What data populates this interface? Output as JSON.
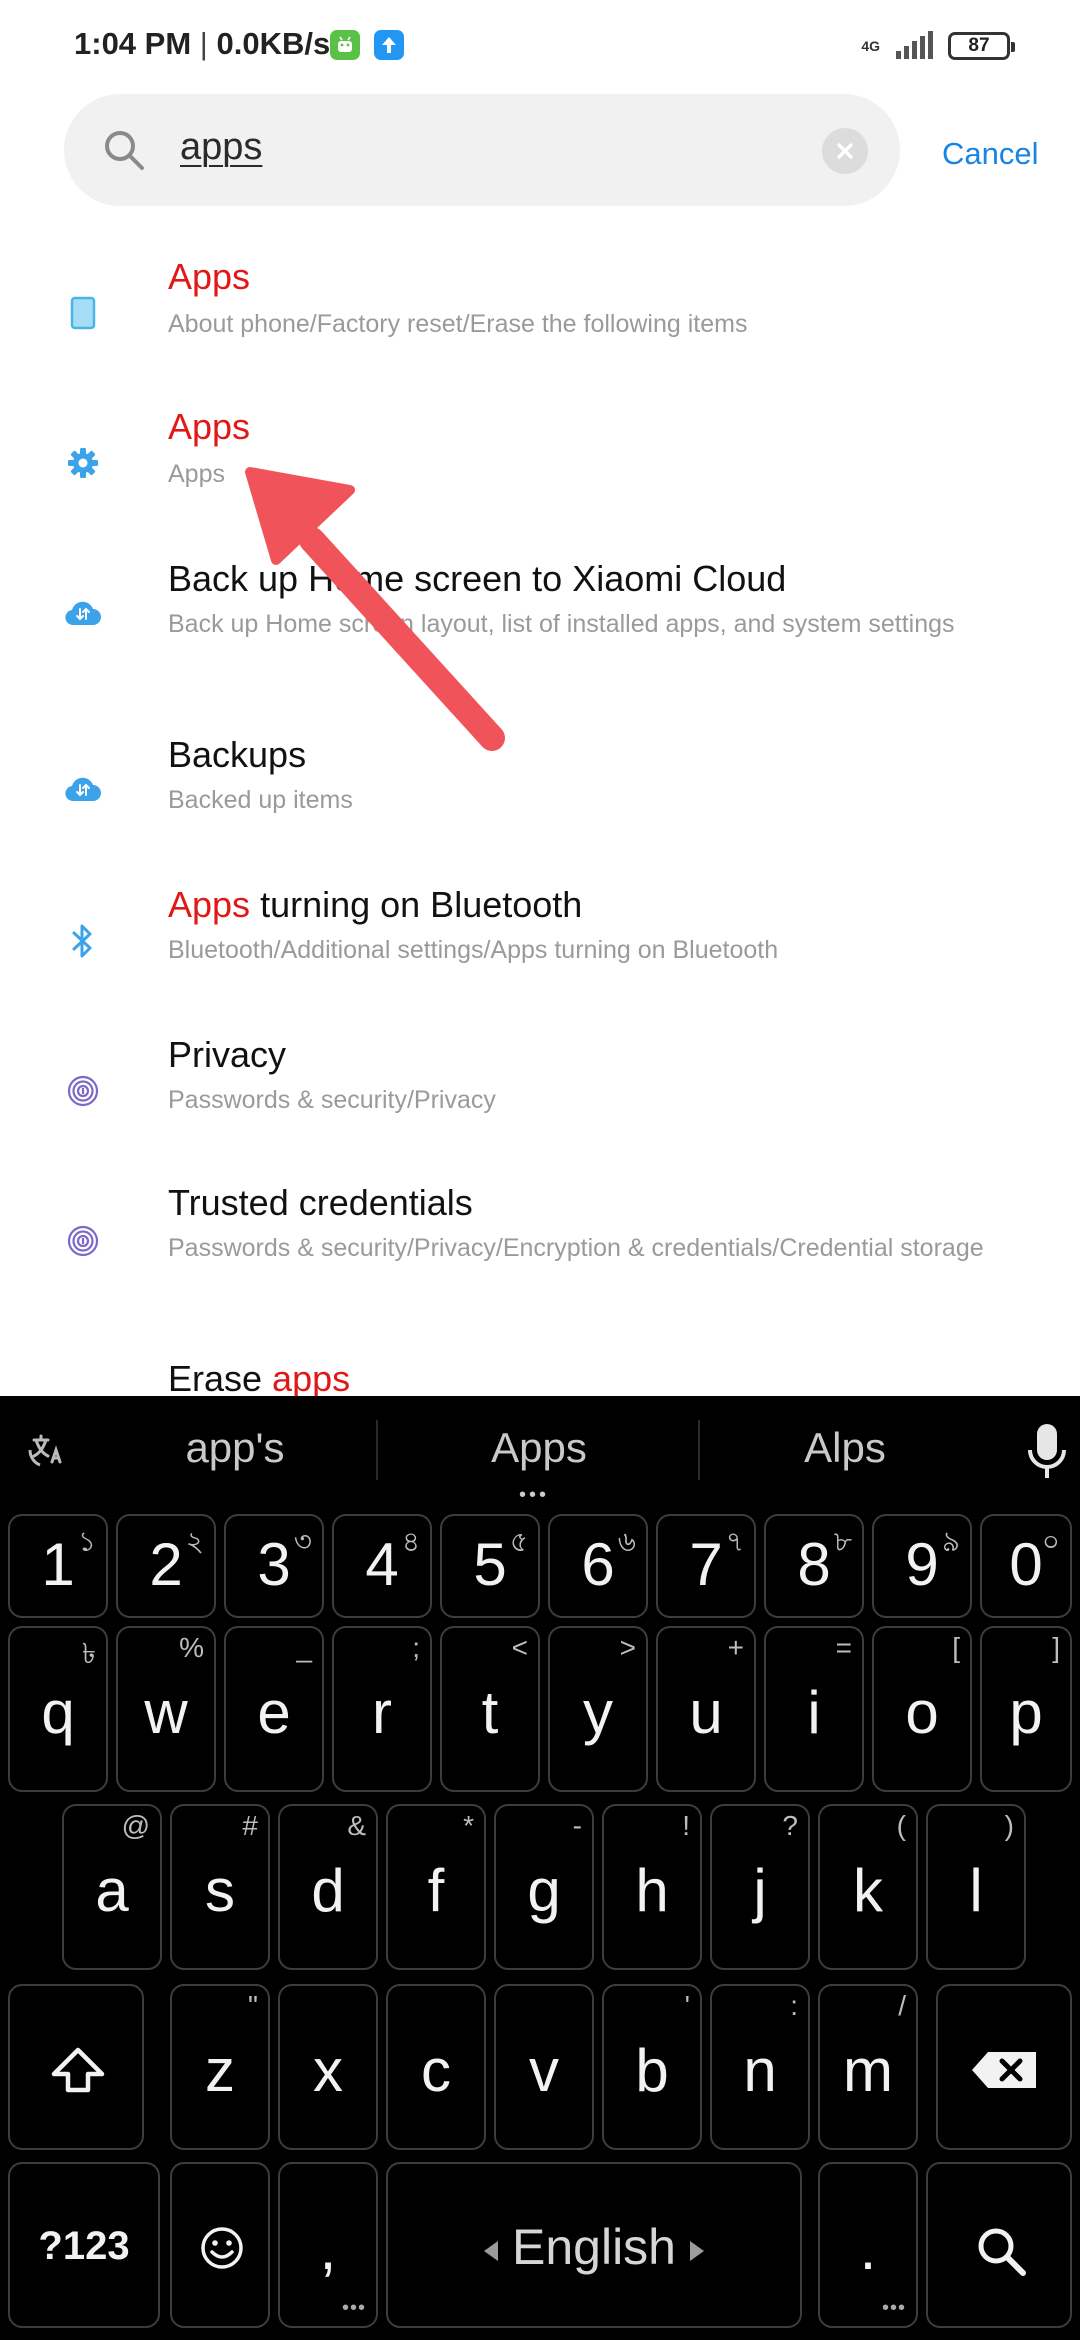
{
  "status_bar": {
    "time": "1:04 PM",
    "separator": "|",
    "speed": "0.0KB/s",
    "network": "4G",
    "battery": "87",
    "icons": [
      "android-notification-icon",
      "upload-notification-icon",
      "signal-icon",
      "battery-icon"
    ]
  },
  "search": {
    "query": "apps",
    "cancel_label": "Cancel"
  },
  "results": [
    {
      "icon": "phone-info-icon",
      "title_parts": [
        {
          "text": "Apps",
          "hl": true
        }
      ],
      "subtitle": "About phone/Factory reset/Erase the following items"
    },
    {
      "icon": "gear-icon",
      "title_parts": [
        {
          "text": "Apps",
          "hl": true
        }
      ],
      "subtitle": "Apps"
    },
    {
      "icon": "cloud-sync-icon",
      "title_parts": [
        {
          "text": "Back up Home screen to Xiaomi Cloud",
          "hl": false
        }
      ],
      "subtitle": "Back up Home screen layout, list of installed apps, and system settings"
    },
    {
      "icon": "cloud-sync-icon",
      "title_parts": [
        {
          "text": "Backups",
          "hl": false
        }
      ],
      "subtitle": "Backed up items"
    },
    {
      "icon": "bluetooth-icon",
      "title_parts": [
        {
          "text": "Apps",
          "hl": true
        },
        {
          "text": " turning on Bluetooth",
          "hl": false
        }
      ],
      "subtitle": "Bluetooth/Additional settings/Apps turning on Bluetooth"
    },
    {
      "icon": "fingerprint-icon",
      "title_parts": [
        {
          "text": "Privacy",
          "hl": false
        }
      ],
      "subtitle": "Passwords & security/Privacy"
    },
    {
      "icon": "fingerprint-icon",
      "title_parts": [
        {
          "text": "Trusted credentials",
          "hl": false
        }
      ],
      "subtitle": "Passwords & security/Privacy/Encryption & credentials/Credential storage"
    },
    {
      "icon": "phone-info-icon",
      "title_parts": [
        {
          "text": "Erase ",
          "hl": false
        },
        {
          "text": "apps",
          "hl": true
        }
      ],
      "subtitle": ""
    }
  ],
  "keyboard": {
    "suggestions": [
      "app's",
      "Apps",
      "Alps"
    ],
    "language": "English",
    "rows": {
      "numbers": [
        [
          "1",
          "১"
        ],
        [
          "2",
          "২"
        ],
        [
          "3",
          "৩"
        ],
        [
          "4",
          "৪"
        ],
        [
          "5",
          "৫"
        ],
        [
          "6",
          "৬"
        ],
        [
          "7",
          "৭"
        ],
        [
          "8",
          "৮"
        ],
        [
          "9",
          "৯"
        ],
        [
          "0",
          "০"
        ]
      ],
      "row1": [
        [
          "q",
          "৳"
        ],
        [
          "w",
          "%"
        ],
        [
          "e",
          "_"
        ],
        [
          "r",
          ";"
        ],
        [
          "t",
          "<"
        ],
        [
          "y",
          ">"
        ],
        [
          "u",
          "+"
        ],
        [
          "i",
          "="
        ],
        [
          "o",
          "["
        ],
        [
          "p",
          "]"
        ]
      ],
      "row2": [
        [
          "a",
          "@"
        ],
        [
          "s",
          "#"
        ],
        [
          "d",
          "&"
        ],
        [
          "f",
          "*"
        ],
        [
          "g",
          "-"
        ],
        [
          "h",
          "!"
        ],
        [
          "j",
          "?"
        ],
        [
          "k",
          "("
        ],
        [
          "l",
          ")"
        ]
      ],
      "row3": [
        [
          "z",
          "\""
        ],
        [
          "x",
          ""
        ],
        [
          "c",
          ""
        ],
        [
          "v",
          ""
        ],
        [
          "b",
          "'"
        ],
        [
          "n",
          ":"
        ],
        [
          "m",
          "/"
        ]
      ]
    },
    "symbols_label": "?123",
    "comma": ",",
    "period": "."
  },
  "colors": {
    "highlight": "#e01818",
    "accent": "#1a84e6",
    "annotation_arrow": "#f0545a"
  }
}
